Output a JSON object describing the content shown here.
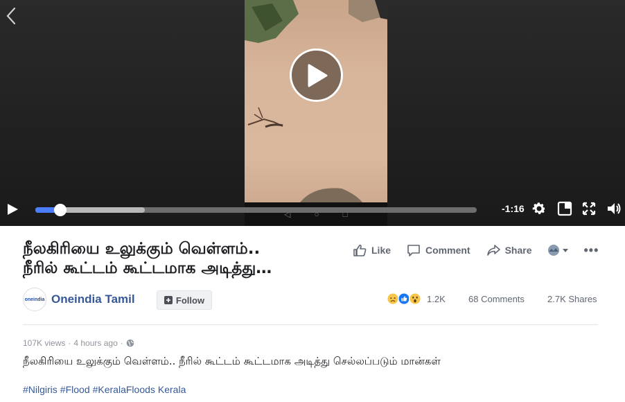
{
  "video": {
    "time_remaining": "-1:16",
    "played_fraction": 0.056,
    "buffered_fraction": 0.248
  },
  "post": {
    "title_line1": "நீலகிரியை உலுக்கும் வெள்ளம்..",
    "title_line2": "நீரில் கூட்டம் கூட்டமாக அடித்து…",
    "actions": {
      "like": "Like",
      "comment": "Comment",
      "share": "Share",
      "more": "•••"
    },
    "page_name": "Oneindia Tamil",
    "logo_text": "oneindia",
    "follow_label": "Follow",
    "reactions_count": "1.2K",
    "comments_count": "68 Comments",
    "shares_count": "2.7K Shares",
    "views": "107K views",
    "separator": "·",
    "time_ago": "4 hours ago",
    "description": "நீலகிரியை உலுக்கும் வெள்ளம்.. நீரில் கூட்டம் கூட்டமாக அடித்து செல்லப்படும் மான்கள்",
    "hashtags": [
      "#Nilgiris",
      "#Flood",
      "#KeralaFloods",
      "Kerala"
    ]
  },
  "colors": {
    "accent_blue": "#4a7dff",
    "link_blue": "#365899",
    "muted_text": "#606770"
  }
}
